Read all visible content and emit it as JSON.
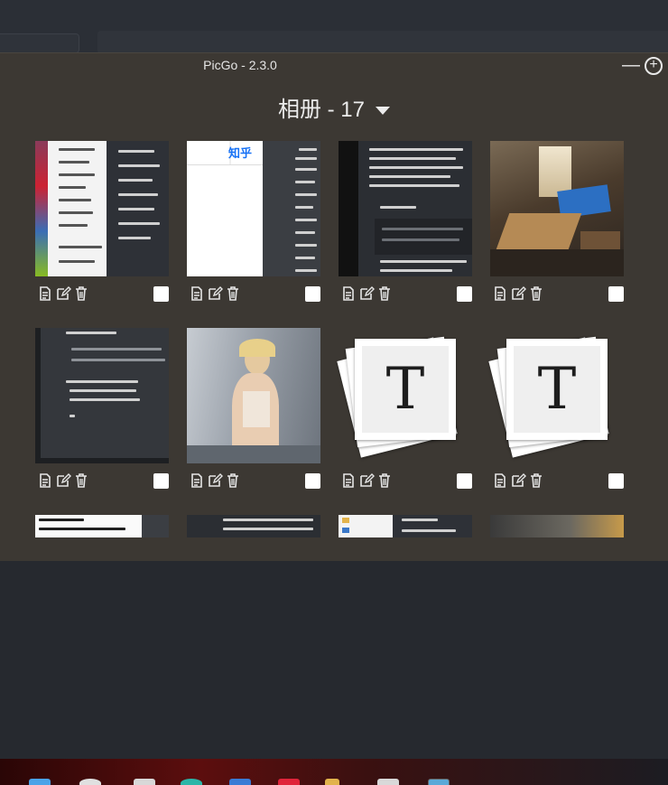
{
  "window": {
    "title": "PicGo - 2.3.0"
  },
  "album": {
    "title": "相册 - 17"
  },
  "gallery": {
    "items": [
      {
        "kind": "desktop"
      },
      {
        "kind": "zhihu",
        "text": "知乎"
      },
      {
        "kind": "doc-dark"
      },
      {
        "kind": "room"
      },
      {
        "kind": "code"
      },
      {
        "kind": "portrait"
      },
      {
        "kind": "typora-logo",
        "letter": "T"
      },
      {
        "kind": "typora-logo",
        "letter": "T"
      },
      {
        "kind": "partial-white"
      },
      {
        "kind": "partial-dark"
      },
      {
        "kind": "partial-desktop"
      },
      {
        "kind": "partial-blur"
      }
    ],
    "action_icons": [
      "copy-icon",
      "edit-icon",
      "delete-icon"
    ]
  },
  "colors": {
    "window_bg": "#3c3833",
    "desktop_bg": "#26292f",
    "accent_text": "#ececec"
  }
}
